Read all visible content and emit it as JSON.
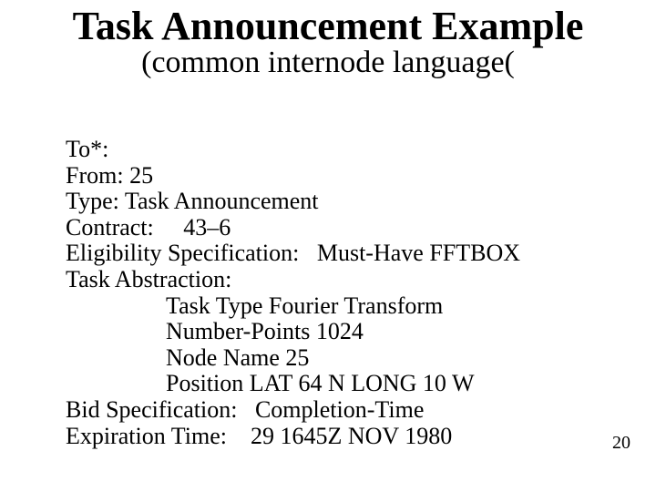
{
  "header": {
    "title": "Task Announcement Example",
    "subtitle": "(common internode language("
  },
  "fields": {
    "to": {
      "label": "To*:",
      "value": ""
    },
    "from": {
      "label": "From:",
      "value": "25"
    },
    "type": {
      "label": "Type:",
      "value": "Task Announcement"
    },
    "contract": {
      "label": "Contract:",
      "value": "43–6"
    },
    "elig": {
      "label": "Eligibility Specification:",
      "value": "Must-Have FFTBOX"
    },
    "abs_hdr": {
      "label": "Task Abstraction:",
      "value": ""
    },
    "abs1": {
      "value": "Task Type Fourier Transform"
    },
    "abs2": {
      "value": "Number-Points 1024"
    },
    "abs3": {
      "value": "Node Name 25"
    },
    "abs4": {
      "value": "Position LAT 64 N LONG 10 W"
    },
    "bid": {
      "label": "Bid Specification:",
      "value": "Completion-Time"
    },
    "exp": {
      "label": "Expiration Time:",
      "value": "29 1645Z NOV 1980"
    }
  },
  "page_number": "20"
}
